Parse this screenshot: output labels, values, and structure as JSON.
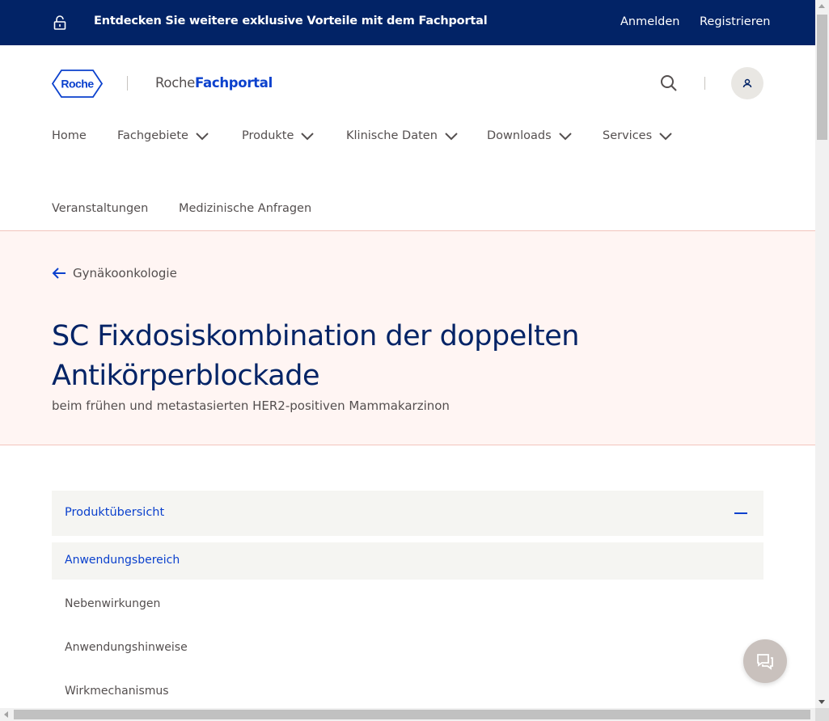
{
  "topbar": {
    "promo": "Entdecken Sie weitere exklusive Vorteile mit dem Fachportal",
    "login": "Anmelden",
    "register": "Registrieren",
    "icon": "lock-open-icon"
  },
  "header": {
    "logo_text": "Roche",
    "portal_prefix": "Roche",
    "portal_suffix": "Fachportal",
    "search_icon": "search-icon",
    "user_icon": "user-icon"
  },
  "nav": {
    "items": [
      {
        "label": "Home",
        "dropdown": false
      },
      {
        "label": "Fachgebiete",
        "dropdown": true
      },
      {
        "label": "Produkte",
        "dropdown": true
      },
      {
        "label": "Klinische Daten",
        "dropdown": true
      },
      {
        "label": "Downloads",
        "dropdown": true
      },
      {
        "label": "Services",
        "dropdown": true
      },
      {
        "label": "Veranstaltungen",
        "dropdown": false
      },
      {
        "label": "Medizinische Anfragen",
        "dropdown": false
      }
    ]
  },
  "hero": {
    "back_label": "Gynäkoonkologie",
    "title": "SC Fixdosiskombination der doppelten Antikörperblockade",
    "subtitle": "beim frühen und metastasierten HER2-positiven Mammakarzinon"
  },
  "accordion": {
    "header": "Produktübersicht",
    "items": [
      {
        "label": "Anwendungsbereich",
        "active": true
      },
      {
        "label": "Nebenwirkungen",
        "active": false
      },
      {
        "label": "Anwendungshinweise",
        "active": false
      },
      {
        "label": "Wirkmechanismus",
        "active": false
      }
    ]
  },
  "colors": {
    "brand_navy": "#022366",
    "brand_blue": "#0b41cd",
    "hero_bg": "#fff5f3",
    "panel_bg": "#f5f5f2"
  },
  "chat": {
    "icon": "chat-icon"
  }
}
